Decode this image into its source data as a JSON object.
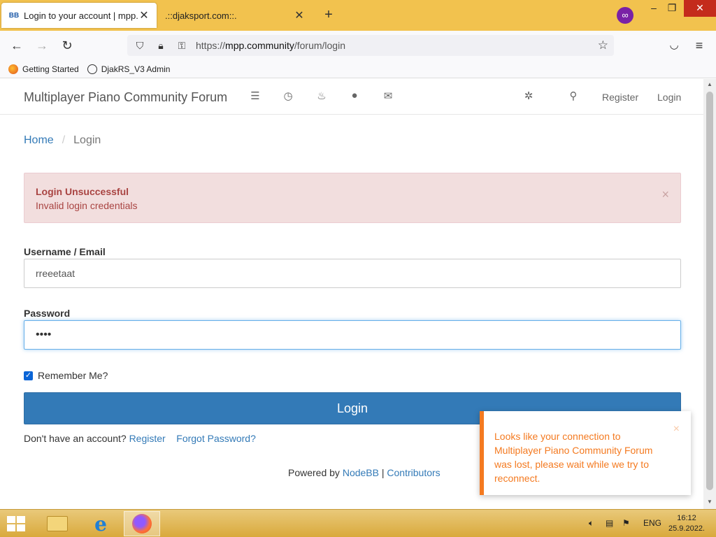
{
  "browser": {
    "tabs": [
      {
        "title": "Login to your account | mpp.co",
        "favicon": "BB"
      },
      {
        "title": ".::djaksport.com::."
      }
    ],
    "url_prefix": "https://",
    "url_host": "mpp.community",
    "url_path": "/forum/login",
    "bookmarks": [
      {
        "label": "Getting Started"
      },
      {
        "label": "DjakRS_V3 Admin"
      }
    ]
  },
  "site": {
    "brand": "Multiplayer Piano Community Forum",
    "nav_register": "Register",
    "nav_login": "Login"
  },
  "breadcrumb": {
    "home": "Home",
    "sep": "/",
    "current": "Login"
  },
  "alert": {
    "title": "Login Unsuccessful",
    "message": "Invalid login credentials",
    "close": "×"
  },
  "form": {
    "username_label": "Username / Email",
    "username_value": "rreeetaat",
    "password_label": "Password",
    "password_value": "••••",
    "remember_label": "Remember Me?",
    "login_button": "Login",
    "no_account": "Don't have an account?",
    "register_link": "Register",
    "forgot_link": "Forgot Password?"
  },
  "footer": {
    "powered_by": "Powered by",
    "nodebb": "NodeBB",
    "sep": "|",
    "contributors": "Contributors"
  },
  "toast": {
    "message": "Looks like your connection to Multiplayer Piano Community Forum was lost, please wait while we try to reconnect.",
    "close": "×"
  },
  "taskbar": {
    "lang": "ENG",
    "time": "16:12",
    "date": "25.9.2022."
  },
  "colors": {
    "tabbar": "#f2c24e",
    "primary": "#337ab7",
    "alert_bg": "#f2dede",
    "alert_text": "#a94442",
    "toast_accent": "#f47a20"
  }
}
